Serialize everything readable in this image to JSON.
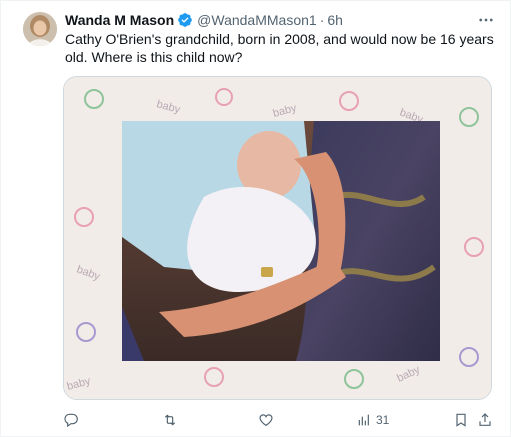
{
  "author": {
    "name": "Wanda M Mason",
    "handle": "@WandaMMason1",
    "separator": "·",
    "time": "6h",
    "verified": true
  },
  "tweet": {
    "text": "Cathy O'Brien's grandchild, born in 2008, and would now be 16 years old. Where is this child now?"
  },
  "media": {
    "watermark_text": "baby"
  },
  "actions": {
    "views_count": "31"
  },
  "icons": {
    "verified": "verified-badge-icon",
    "more": "more-options-icon",
    "reply": "reply-icon",
    "retweet": "retweet-icon",
    "like": "like-icon",
    "views": "views-icon",
    "bookmark": "bookmark-icon",
    "share": "share-icon"
  },
  "colors": {
    "verified_blue": "#1d9bf0",
    "secondary_text": "#536471",
    "primary_text": "#0f1419"
  }
}
